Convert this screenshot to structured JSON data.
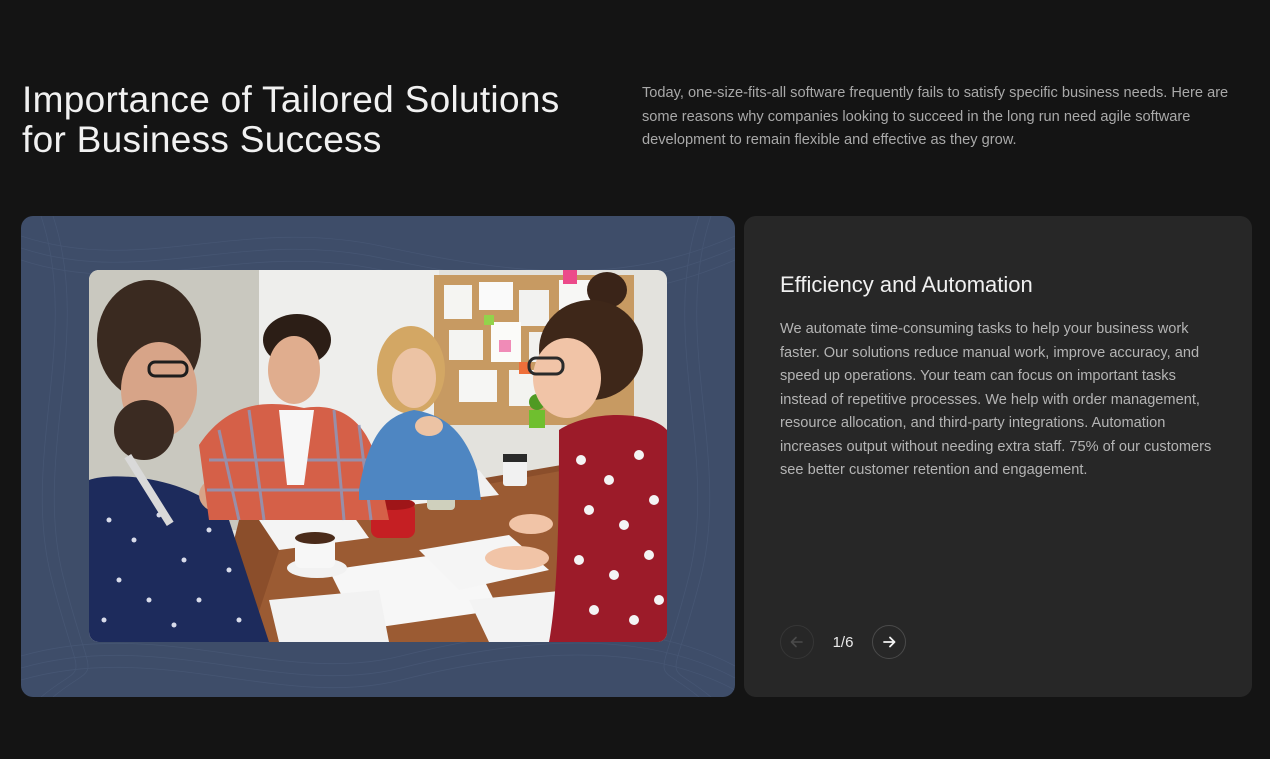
{
  "section": {
    "title_line1": "Importance of Tailored Solutions",
    "title_line2": "for Business Success",
    "intro": "Today, one-size-fits-all software frequently fails to satisfy specific business needs. Here are some reasons why companies looking to succeed in the long run need agile software development to remain flexible and effective as they grow."
  },
  "slide": {
    "title": "Efficiency and Automation",
    "body": "We automate time-consuming tasks to help your business work faster. Our solutions reduce manual work, improve accuracy, and speed up operations. Your team can focus on important tasks instead of repetitive processes. We help with order management, resource allocation, and third-party integrations. Automation increases output without needing extra staff. 75% of our customers see better customer retention and engagement.",
    "image_icon": "team-meeting-photo"
  },
  "pager": {
    "counter": "1/6",
    "prev_icon": "arrow-left-icon",
    "next_icon": "arrow-right-icon"
  },
  "colors": {
    "background": "#141414",
    "image_card": "#3e4d69",
    "text_card": "#272727"
  }
}
